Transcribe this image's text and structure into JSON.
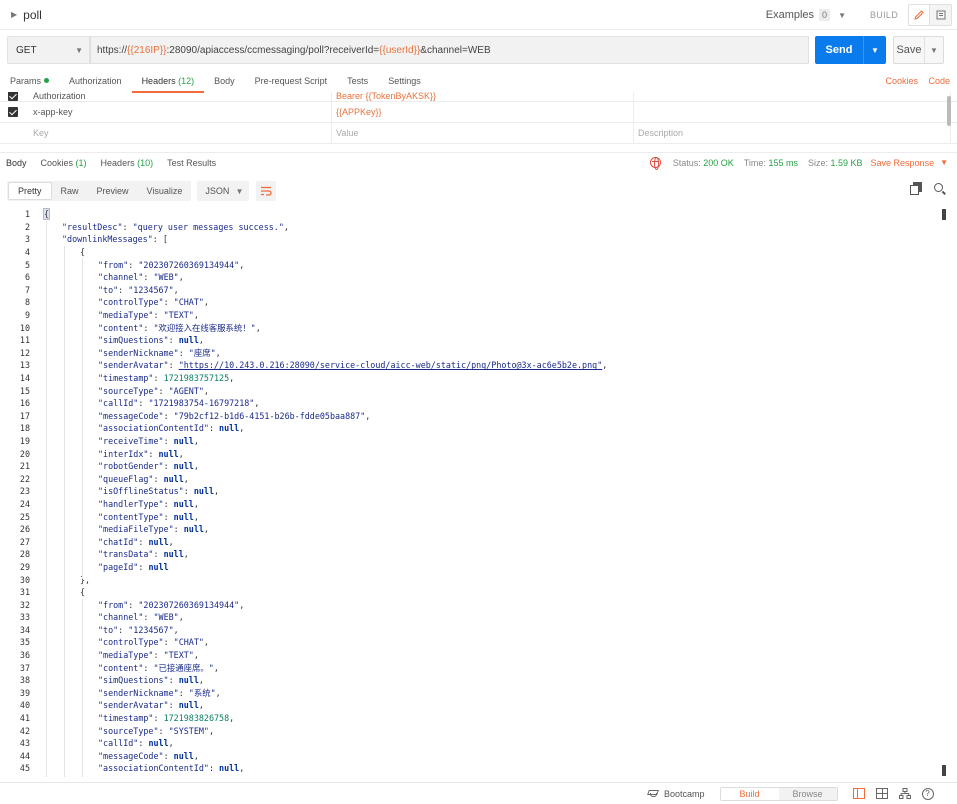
{
  "titlebar": {
    "title": "poll",
    "examples_label": "Examples",
    "examples_count": "0",
    "build_label": "BUILD"
  },
  "request": {
    "method": "GET",
    "url_parts": [
      {
        "text": "https://",
        "var": false
      },
      {
        "text": "{{216IP}}",
        "var": true
      },
      {
        "text": ":28090/apiaccess/ccmessaging/poll?receiverId=",
        "var": false
      },
      {
        "text": "{{userId}}",
        "var": true
      },
      {
        "text": "&channel=WEB",
        "var": false
      }
    ],
    "send_label": "Send",
    "save_label": "Save"
  },
  "req_tabs": {
    "params": "Params",
    "authorization": "Authorization",
    "headers": "Headers",
    "headers_count": "(12)",
    "body": "Body",
    "prerequest": "Pre-request Script",
    "tests": "Tests",
    "settings": "Settings",
    "cookies": "Cookies",
    "code": "Code"
  },
  "headers_table": {
    "rows": [
      {
        "key": "Authorization",
        "value": "Bearer {{TokenByAKSK}}"
      },
      {
        "key": "x-app-key",
        "value": "{{APPKey}}"
      }
    ],
    "placeholder": {
      "key": "Key",
      "value": "Value",
      "description": "Description"
    }
  },
  "resp_tabs": {
    "body": "Body",
    "cookies": "Cookies",
    "cookies_count": "(1)",
    "headers": "Headers",
    "headers_count": "(10)",
    "test_results": "Test Results",
    "status_label": "Status:",
    "status_value": "200 OK",
    "time_label": "Time:",
    "time_value": "155 ms",
    "size_label": "Size:",
    "size_value": "1.59 KB",
    "save_response": "Save Response"
  },
  "body_toolbar": {
    "modes": [
      "Pretty",
      "Raw",
      "Preview",
      "Visualize"
    ],
    "selected_mode": "Pretty",
    "format": "JSON"
  },
  "code_lines": [
    {
      "n": "1",
      "i": 0,
      "t": [
        [
          "p",
          "{"
        ]
      ]
    },
    {
      "n": "2",
      "i": 1,
      "t": [
        [
          "s",
          "\"resultDesc\""
        ],
        [
          "p",
          ": "
        ],
        [
          "s",
          "\"query user messages success.\""
        ],
        [
          "p",
          ","
        ]
      ]
    },
    {
      "n": "3",
      "i": 1,
      "t": [
        [
          "s",
          "\"downlinkMessages\""
        ],
        [
          "p",
          ": ["
        ]
      ]
    },
    {
      "n": "4",
      "i": 2,
      "t": [
        [
          "p",
          "{"
        ]
      ]
    },
    {
      "n": "5",
      "i": 3,
      "t": [
        [
          "s",
          "\"from\""
        ],
        [
          "p",
          ": "
        ],
        [
          "s",
          "\"202307260369134944\""
        ],
        [
          "p",
          ","
        ]
      ]
    },
    {
      "n": "6",
      "i": 3,
      "t": [
        [
          "s",
          "\"channel\""
        ],
        [
          "p",
          ": "
        ],
        [
          "s",
          "\"WEB\""
        ],
        [
          "p",
          ","
        ]
      ]
    },
    {
      "n": "7",
      "i": 3,
      "t": [
        [
          "s",
          "\"to\""
        ],
        [
          "p",
          ": "
        ],
        [
          "s",
          "\"1234567\""
        ],
        [
          "p",
          ","
        ]
      ]
    },
    {
      "n": "8",
      "i": 3,
      "t": [
        [
          "s",
          "\"controlType\""
        ],
        [
          "p",
          ": "
        ],
        [
          "s",
          "\"CHAT\""
        ],
        [
          "p",
          ","
        ]
      ]
    },
    {
      "n": "9",
      "i": 3,
      "t": [
        [
          "s",
          "\"mediaType\""
        ],
        [
          "p",
          ": "
        ],
        [
          "s",
          "\"TEXT\""
        ],
        [
          "p",
          ","
        ]
      ]
    },
    {
      "n": "10",
      "i": 3,
      "t": [
        [
          "s",
          "\"content\""
        ],
        [
          "p",
          ": "
        ],
        [
          "s",
          "\"欢迎接入在线客服系统！\""
        ],
        [
          "p",
          ","
        ]
      ]
    },
    {
      "n": "11",
      "i": 3,
      "t": [
        [
          "s",
          "\"simQuestions\""
        ],
        [
          "p",
          ": "
        ],
        [
          "nl",
          "null"
        ],
        [
          "p",
          ","
        ]
      ]
    },
    {
      "n": "12",
      "i": 3,
      "t": [
        [
          "s",
          "\"senderNickname\""
        ],
        [
          "p",
          ": "
        ],
        [
          "s",
          "\"座席\""
        ],
        [
          "p",
          ","
        ]
      ]
    },
    {
      "n": "13",
      "i": 3,
      "t": [
        [
          "s",
          "\"senderAvatar\""
        ],
        [
          "p",
          ": "
        ],
        [
          "lnk",
          "\"https://10.243.0.216:28090/service-cloud/aicc-web/static/png/Photo@3x-ac6e5b2e.png\""
        ],
        [
          "p",
          ","
        ]
      ]
    },
    {
      "n": "14",
      "i": 3,
      "t": [
        [
          "s",
          "\"timestamp\""
        ],
        [
          "p",
          ": "
        ],
        [
          "n",
          "1721983757125"
        ],
        [
          "p",
          ","
        ]
      ]
    },
    {
      "n": "15",
      "i": 3,
      "t": [
        [
          "s",
          "\"sourceType\""
        ],
        [
          "p",
          ": "
        ],
        [
          "s",
          "\"AGENT\""
        ],
        [
          "p",
          ","
        ]
      ]
    },
    {
      "n": "16",
      "i": 3,
      "t": [
        [
          "s",
          "\"callId\""
        ],
        [
          "p",
          ": "
        ],
        [
          "s",
          "\"1721983754-16797218\""
        ],
        [
          "p",
          ","
        ]
      ]
    },
    {
      "n": "17",
      "i": 3,
      "t": [
        [
          "s",
          "\"messageCode\""
        ],
        [
          "p",
          ": "
        ],
        [
          "s",
          "\"79b2cf12-b1d6-4151-b26b-fdde05baa887\""
        ],
        [
          "p",
          ","
        ]
      ]
    },
    {
      "n": "18",
      "i": 3,
      "t": [
        [
          "s",
          "\"associationContentId\""
        ],
        [
          "p",
          ": "
        ],
        [
          "nl",
          "null"
        ],
        [
          "p",
          ","
        ]
      ]
    },
    {
      "n": "19",
      "i": 3,
      "t": [
        [
          "s",
          "\"receiveTime\""
        ],
        [
          "p",
          ": "
        ],
        [
          "nl",
          "null"
        ],
        [
          "p",
          ","
        ]
      ]
    },
    {
      "n": "20",
      "i": 3,
      "t": [
        [
          "s",
          "\"interIdx\""
        ],
        [
          "p",
          ": "
        ],
        [
          "nl",
          "null"
        ],
        [
          "p",
          ","
        ]
      ]
    },
    {
      "n": "21",
      "i": 3,
      "t": [
        [
          "s",
          "\"robotGender\""
        ],
        [
          "p",
          ": "
        ],
        [
          "nl",
          "null"
        ],
        [
          "p",
          ","
        ]
      ]
    },
    {
      "n": "22",
      "i": 3,
      "t": [
        [
          "s",
          "\"queueFlag\""
        ],
        [
          "p",
          ": "
        ],
        [
          "nl",
          "null"
        ],
        [
          "p",
          ","
        ]
      ]
    },
    {
      "n": "23",
      "i": 3,
      "t": [
        [
          "s",
          "\"isOfflineStatus\""
        ],
        [
          "p",
          ": "
        ],
        [
          "nl",
          "null"
        ],
        [
          "p",
          ","
        ]
      ]
    },
    {
      "n": "24",
      "i": 3,
      "t": [
        [
          "s",
          "\"handlerType\""
        ],
        [
          "p",
          ": "
        ],
        [
          "nl",
          "null"
        ],
        [
          "p",
          ","
        ]
      ]
    },
    {
      "n": "25",
      "i": 3,
      "t": [
        [
          "s",
          "\"contentType\""
        ],
        [
          "p",
          ": "
        ],
        [
          "nl",
          "null"
        ],
        [
          "p",
          ","
        ]
      ]
    },
    {
      "n": "26",
      "i": 3,
      "t": [
        [
          "s",
          "\"mediaFileType\""
        ],
        [
          "p",
          ": "
        ],
        [
          "nl",
          "null"
        ],
        [
          "p",
          ","
        ]
      ]
    },
    {
      "n": "27",
      "i": 3,
      "t": [
        [
          "s",
          "\"chatId\""
        ],
        [
          "p",
          ": "
        ],
        [
          "nl",
          "null"
        ],
        [
          "p",
          ","
        ]
      ]
    },
    {
      "n": "28",
      "i": 3,
      "t": [
        [
          "s",
          "\"transData\""
        ],
        [
          "p",
          ": "
        ],
        [
          "nl",
          "null"
        ],
        [
          "p",
          ","
        ]
      ]
    },
    {
      "n": "29",
      "i": 3,
      "t": [
        [
          "s",
          "\"pageId\""
        ],
        [
          "p",
          ": "
        ],
        [
          "nl",
          "null"
        ]
      ]
    },
    {
      "n": "30",
      "i": 2,
      "t": [
        [
          "p",
          "},"
        ]
      ]
    },
    {
      "n": "31",
      "i": 2,
      "t": [
        [
          "p",
          "{"
        ]
      ]
    },
    {
      "n": "32",
      "i": 3,
      "t": [
        [
          "s",
          "\"from\""
        ],
        [
          "p",
          ": "
        ],
        [
          "s",
          "\"202307260369134944\""
        ],
        [
          "p",
          ","
        ]
      ]
    },
    {
      "n": "33",
      "i": 3,
      "t": [
        [
          "s",
          "\"channel\""
        ],
        [
          "p",
          ": "
        ],
        [
          "s",
          "\"WEB\""
        ],
        [
          "p",
          ","
        ]
      ]
    },
    {
      "n": "34",
      "i": 3,
      "t": [
        [
          "s",
          "\"to\""
        ],
        [
          "p",
          ": "
        ],
        [
          "s",
          "\"1234567\""
        ],
        [
          "p",
          ","
        ]
      ]
    },
    {
      "n": "35",
      "i": 3,
      "t": [
        [
          "s",
          "\"controlType\""
        ],
        [
          "p",
          ": "
        ],
        [
          "s",
          "\"CHAT\""
        ],
        [
          "p",
          ","
        ]
      ]
    },
    {
      "n": "36",
      "i": 3,
      "t": [
        [
          "s",
          "\"mediaType\""
        ],
        [
          "p",
          ": "
        ],
        [
          "s",
          "\"TEXT\""
        ],
        [
          "p",
          ","
        ]
      ]
    },
    {
      "n": "37",
      "i": 3,
      "t": [
        [
          "s",
          "\"content\""
        ],
        [
          "p",
          ": "
        ],
        [
          "s",
          "\"已接通座席。\""
        ],
        [
          "p",
          ","
        ]
      ]
    },
    {
      "n": "38",
      "i": 3,
      "t": [
        [
          "s",
          "\"simQuestions\""
        ],
        [
          "p",
          ": "
        ],
        [
          "nl",
          "null"
        ],
        [
          "p",
          ","
        ]
      ]
    },
    {
      "n": "39",
      "i": 3,
      "t": [
        [
          "s",
          "\"senderNickname\""
        ],
        [
          "p",
          ": "
        ],
        [
          "s",
          "\"系统\""
        ],
        [
          "p",
          ","
        ]
      ]
    },
    {
      "n": "40",
      "i": 3,
      "t": [
        [
          "s",
          "\"senderAvatar\""
        ],
        [
          "p",
          ": "
        ],
        [
          "nl",
          "null"
        ],
        [
          "p",
          ","
        ]
      ]
    },
    {
      "n": "41",
      "i": 3,
      "t": [
        [
          "s",
          "\"timestamp\""
        ],
        [
          "p",
          ": "
        ],
        [
          "n",
          "1721983826758"
        ],
        [
          "p",
          ","
        ]
      ]
    },
    {
      "n": "42",
      "i": 3,
      "t": [
        [
          "s",
          "\"sourceType\""
        ],
        [
          "p",
          ": "
        ],
        [
          "s",
          "\"SYSTEM\""
        ],
        [
          "p",
          ","
        ]
      ]
    },
    {
      "n": "43",
      "i": 3,
      "t": [
        [
          "s",
          "\"callId\""
        ],
        [
          "p",
          ": "
        ],
        [
          "nl",
          "null"
        ],
        [
          "p",
          ","
        ]
      ]
    },
    {
      "n": "44",
      "i": 3,
      "t": [
        [
          "s",
          "\"messageCode\""
        ],
        [
          "p",
          ": "
        ],
        [
          "nl",
          "null"
        ],
        [
          "p",
          ","
        ]
      ]
    },
    {
      "n": "45",
      "i": 3,
      "t": [
        [
          "s",
          "\"associationContentId\""
        ],
        [
          "p",
          ": "
        ],
        [
          "nl",
          "null"
        ],
        [
          "p",
          ","
        ]
      ]
    }
  ],
  "footer": {
    "bootcamp": "Bootcamp",
    "build": "Build",
    "browse": "Browse",
    "help": "?"
  },
  "colors": {
    "accent_orange": "#f26b3a",
    "send_blue": "#097bed",
    "status_green": "#27a046",
    "var_orange": "#e6743e"
  }
}
